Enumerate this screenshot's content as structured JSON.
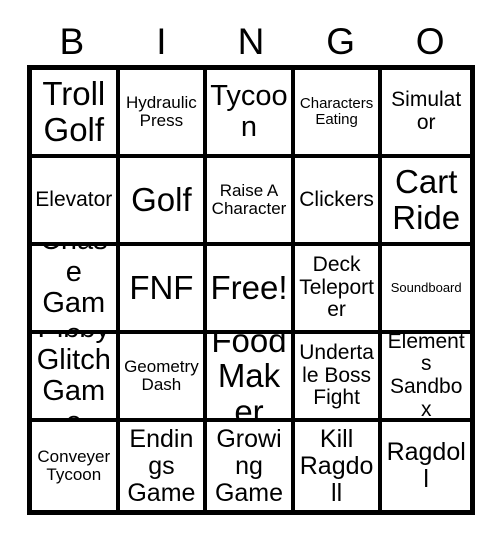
{
  "card": {
    "type": "bingo-card",
    "columns": 5,
    "rows": 5,
    "header_letters": [
      "B",
      "I",
      "N",
      "G",
      "O"
    ],
    "free_space": {
      "row": 2,
      "column": 2,
      "label": "Free!"
    },
    "colors": {
      "border": "#000000",
      "background": "#ffffff",
      "text": "#000000"
    },
    "cells": [
      {
        "text": "Troll Golf",
        "size": "fs-xxl"
      },
      {
        "text": "Hydraulic Press",
        "size": "fs-sm"
      },
      {
        "text": "Tycoon",
        "size": "fs-xl"
      },
      {
        "text": "Characters Eating",
        "size": "fs-xs"
      },
      {
        "text": "Simulator",
        "size": "fs-md"
      },
      {
        "text": "Elevator",
        "size": "fs-md"
      },
      {
        "text": "Golf",
        "size": "fs-xxl"
      },
      {
        "text": "Raise A Character",
        "size": "fs-sm"
      },
      {
        "text": "Clickers",
        "size": "fs-md"
      },
      {
        "text": "Cart Ride",
        "size": "fs-xxl"
      },
      {
        "text": "Chase Game",
        "size": "fs-xl"
      },
      {
        "text": "FNF",
        "size": "fs-xxl"
      },
      {
        "text": "Free!",
        "size": "fs-xxl"
      },
      {
        "text": "Deck Teleporter",
        "size": "fs-md"
      },
      {
        "text": "Soundboard",
        "size": "fs-xxs"
      },
      {
        "text": "Pibby Glitch Game",
        "size": "fs-xl"
      },
      {
        "text": "Geometry Dash",
        "size": "fs-sm"
      },
      {
        "text": "Food Maker",
        "size": "fs-xxl"
      },
      {
        "text": "Undertale Boss Fight",
        "size": "fs-md"
      },
      {
        "text": "Elements Sandbox",
        "size": "fs-md"
      },
      {
        "text": "Conveyer Tycoon",
        "size": "fs-sm"
      },
      {
        "text": "Endings Game",
        "size": "fs-lg"
      },
      {
        "text": "Growing Game",
        "size": "fs-lg"
      },
      {
        "text": "Kill Ragdoll",
        "size": "fs-lg"
      },
      {
        "text": "Ragdoll",
        "size": "fs-lg"
      }
    ]
  }
}
